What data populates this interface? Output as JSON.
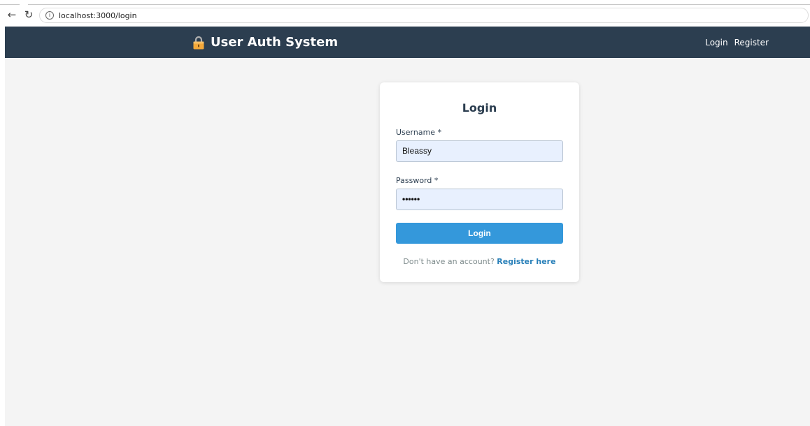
{
  "browser": {
    "back_icon": "←",
    "reload_icon": "↻",
    "info_icon": "i",
    "url": "localhost:3000/login"
  },
  "navbar": {
    "brand_icon": "lock-icon",
    "brand_title": "User Auth System",
    "links": {
      "login": "Login",
      "register": "Register"
    },
    "background_color": "#2c3e50"
  },
  "login_form": {
    "title": "Login",
    "username": {
      "label": "Username *",
      "value": "Bleassy"
    },
    "password": {
      "label": "Password *",
      "masked_value": "••••••"
    },
    "submit_label": "Login",
    "footer_prompt": "Don't have an account?",
    "register_link": "Register here",
    "accent_color": "#3498db"
  }
}
